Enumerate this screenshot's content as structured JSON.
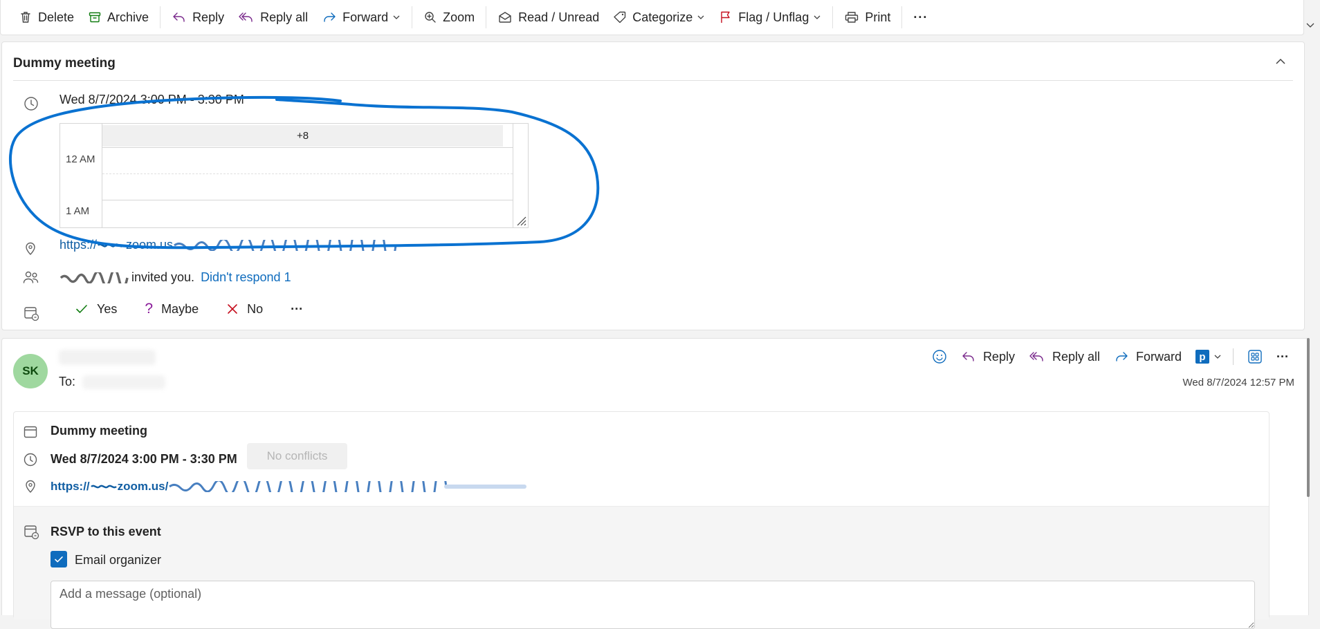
{
  "toolbar": {
    "delete": "Delete",
    "archive": "Archive",
    "reply": "Reply",
    "reply_all": "Reply all",
    "forward": "Forward",
    "zoom": "Zoom",
    "read_unread": "Read / Unread",
    "categorize": "Categorize",
    "flag_unflag": "Flag / Unflag",
    "print": "Print",
    "more": "···"
  },
  "event_card": {
    "title": "Dummy meeting",
    "datetime": "Wed 8/7/2024 3:00 PM - 3:30 PM",
    "calendar": {
      "header": "+8",
      "hours": [
        "12 AM",
        "1 AM"
      ]
    },
    "location_link": "https://",
    "location_link_domain": "zoom.us",
    "invite_text": "invited you.",
    "response_status": "Didn't respond 1",
    "rsvp": {
      "yes": "Yes",
      "maybe": "Maybe",
      "no": "No",
      "more": "···"
    }
  },
  "message": {
    "avatar_initials": "SK",
    "to_label": "To:",
    "actions": {
      "reply": "Reply",
      "reply_all": "Reply all",
      "forward": "Forward",
      "more": "···"
    },
    "timestamp": "Wed 8/7/2024 12:57 PM",
    "event": {
      "title": "Dummy meeting",
      "time": "Wed 8/7/2024 3:00 PM - 3:30 PM",
      "conflicts": "No conflicts",
      "link_prefix": "https://",
      "link_domain": "zoom.us/",
      "rsvp_title": "RSVP to this event",
      "email_organizer_label": "Email organizer",
      "email_organizer_checked": true,
      "message_placeholder": "Add a message (optional)"
    }
  },
  "colors": {
    "accent": "#0f6cbd",
    "link": "#115ea3",
    "ink_annotation": "#0a72d1",
    "avatar_bg": "#9fd89f",
    "yes_green": "#107c10",
    "maybe_purple": "#881798",
    "no_red": "#c50f1f",
    "flag_red": "#c50f1f",
    "archive_green": "#107c10",
    "reply_purple": "#7a2a8c",
    "forward_blue": "#0f6cbd"
  }
}
